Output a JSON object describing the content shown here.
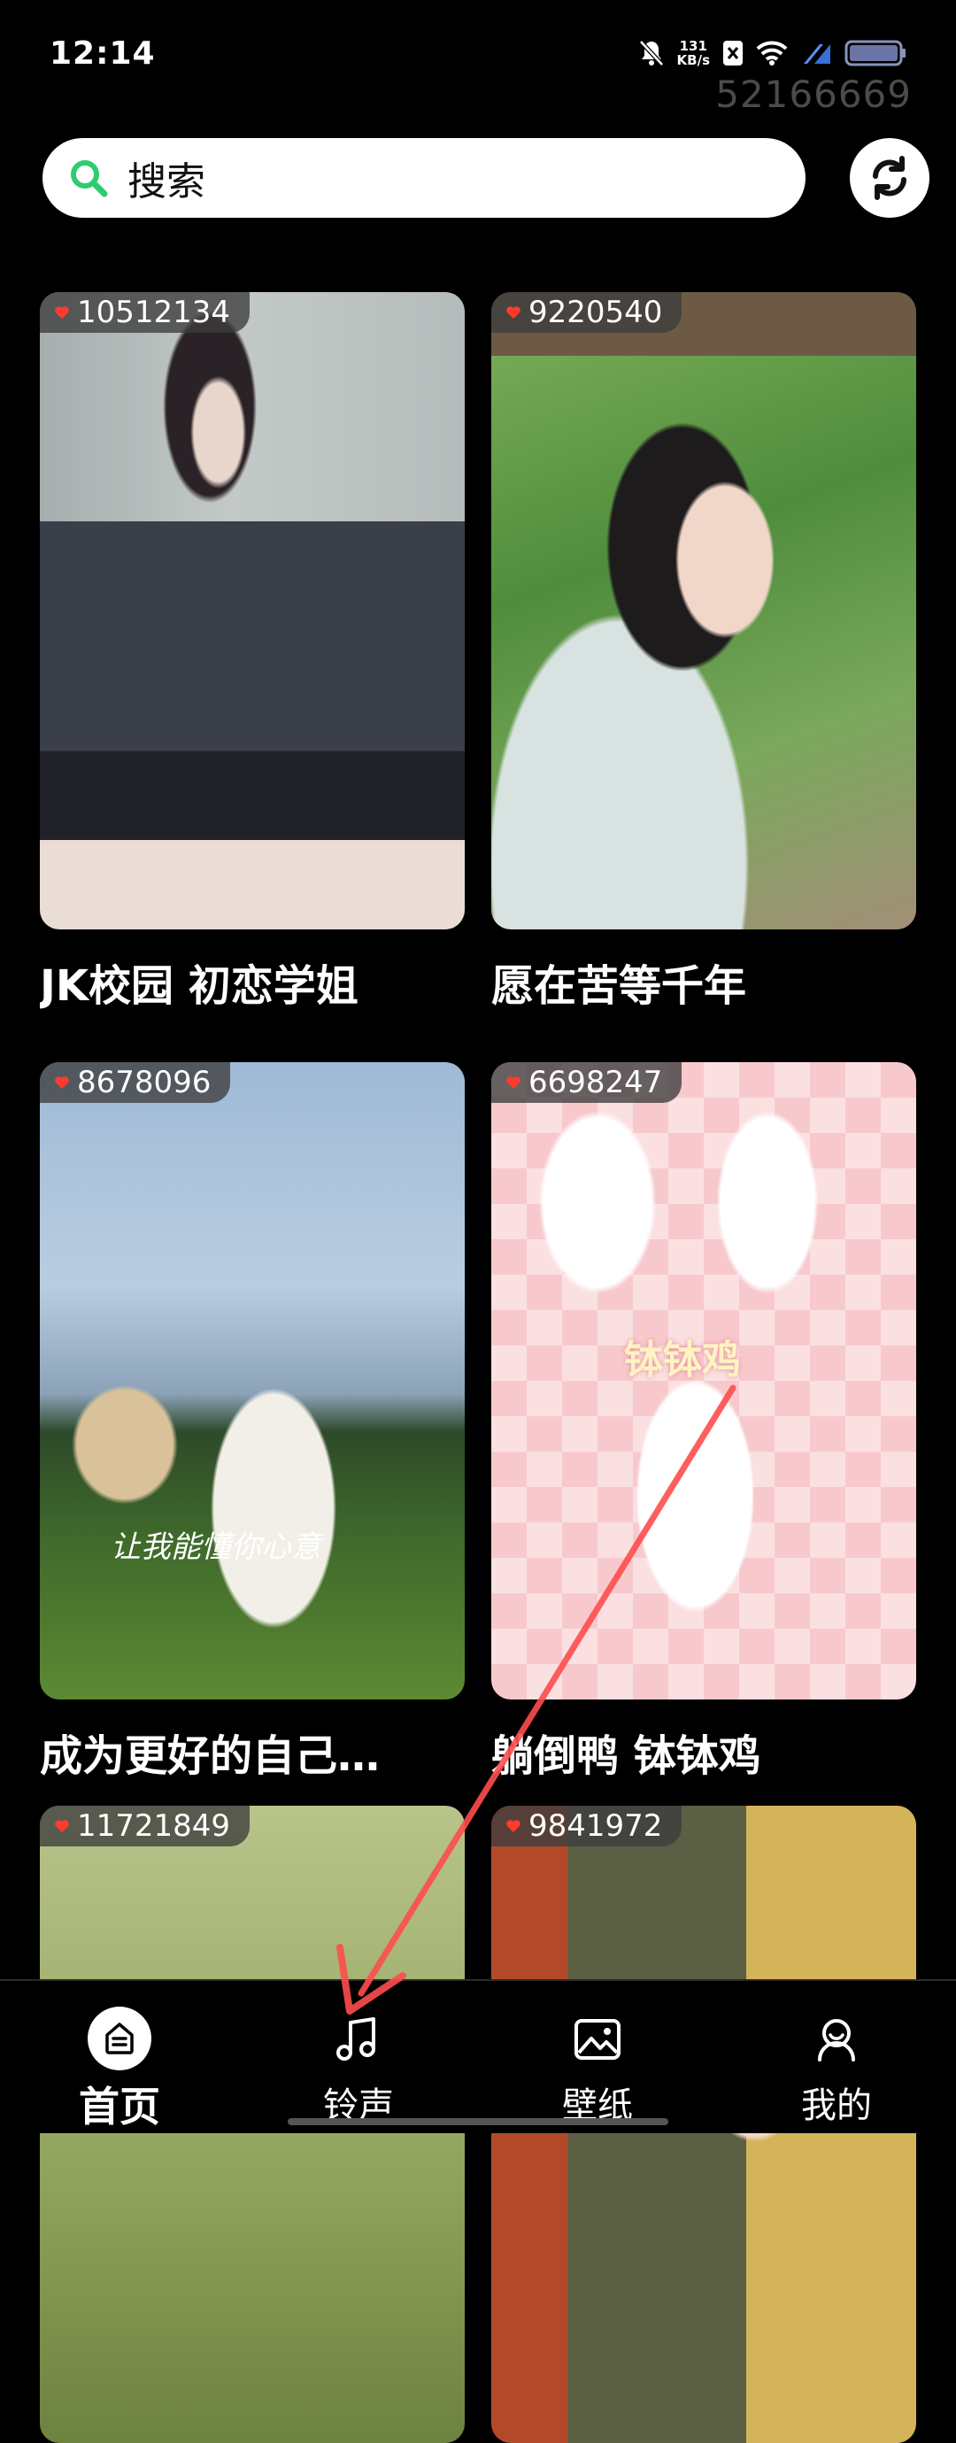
{
  "status_bar": {
    "time": "12:14",
    "net_speed_value": "131",
    "net_speed_unit": "KB/s",
    "watermark": "52166669"
  },
  "search": {
    "placeholder": "搜索",
    "icon": "search-icon"
  },
  "cards": [
    {
      "likes": "10512134",
      "title": "JK校园 初恋学姐"
    },
    {
      "likes": "9220540",
      "title": "愿在苦等千年"
    },
    {
      "likes": "8678096",
      "title": "成为更好的自己…",
      "caption": "让我能懂你心意"
    },
    {
      "likes": "6698247",
      "title": "躺倒鸭 钵钵鸡",
      "overlay_text": "钵钵鸡"
    },
    {
      "likes": "11721849",
      "title": ""
    },
    {
      "likes": "9841972",
      "title": ""
    }
  ],
  "bottom_nav": {
    "items": [
      {
        "label": "首页",
        "icon": "home-icon",
        "active": true
      },
      {
        "label": "铃声",
        "icon": "music-note-icon",
        "active": false
      },
      {
        "label": "壁纸",
        "icon": "wallpaper-icon",
        "active": false
      },
      {
        "label": "我的",
        "icon": "profile-icon",
        "active": false
      }
    ]
  },
  "colors": {
    "background": "#000000",
    "search_accent": "#2ecc71",
    "heart": "#ff3b30",
    "annotation": "#ff4d4d"
  }
}
